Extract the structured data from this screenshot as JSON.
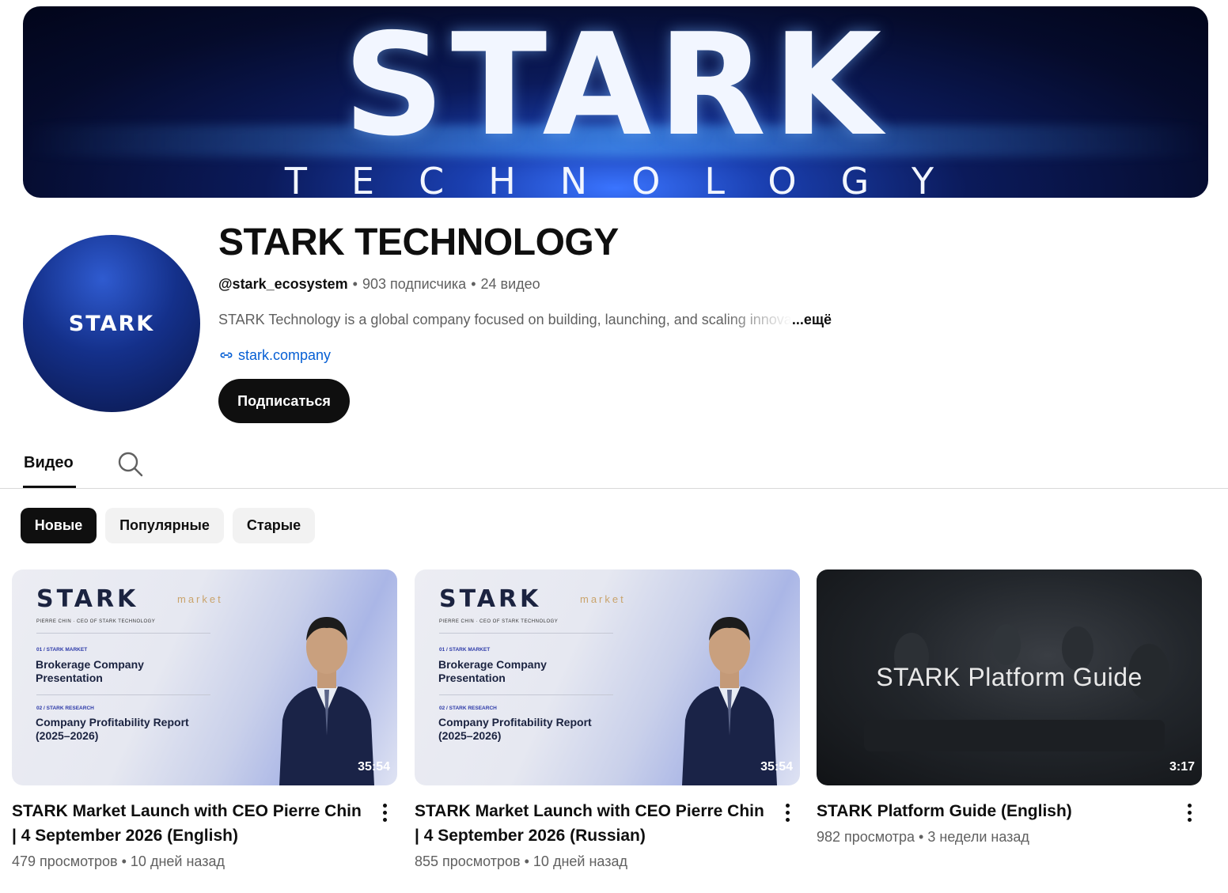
{
  "banner": {
    "word": "STARK",
    "subword": "TECHNOLOGY"
  },
  "avatar": {
    "label": "STARK"
  },
  "channel": {
    "title": "STARK TECHNOLOGY",
    "handle": "@stark_ecosystem",
    "subscribers": "903 подписчика",
    "videos": "24 видео",
    "description": "STARK Technology is a global company focused on building, launching, and scaling innova",
    "more": "...ещё",
    "link": "stark.company",
    "subscribe_label": "Подписаться"
  },
  "tabs": {
    "videos": "Видео"
  },
  "chips": [
    "Новые",
    "Популярные",
    "Старые"
  ],
  "thumb_text": {
    "logo": "STARK",
    "market": "market",
    "ceo": "PIERRE CHIN · CEO OF STARK TECHNOLOGY",
    "n1": "01 / STARK MARKET",
    "t1": "Brokerage Company Presentation",
    "n2": "02 / STARK RESEARCH",
    "t2": "Company Profitability Report (2025–2026)",
    "guide": "STARK Platform Guide"
  },
  "videos": [
    {
      "title": "STARK Market Launch with CEO Pierre Chin | 4 September 2026 (English)",
      "duration": "35:54",
      "stats": "479 просмотров • 10 дней назад"
    },
    {
      "title": "STARK Market Launch with CEO Pierre Chin | 4 September 2026 (Russian)",
      "duration": "35:54",
      "stats": "855 просмотров • 10 дней назад"
    },
    {
      "title": "STARK Platform Guide (English)",
      "duration": "3:17",
      "stats": "982 просмотра • 3 недели назад"
    }
  ],
  "icons": {
    "link": "link-icon",
    "search": "search-icon",
    "menu": "more-vert-icon"
  },
  "colors": {
    "link": "#065fd4",
    "primary": "#0f0f0f",
    "secondary": "#606060"
  }
}
